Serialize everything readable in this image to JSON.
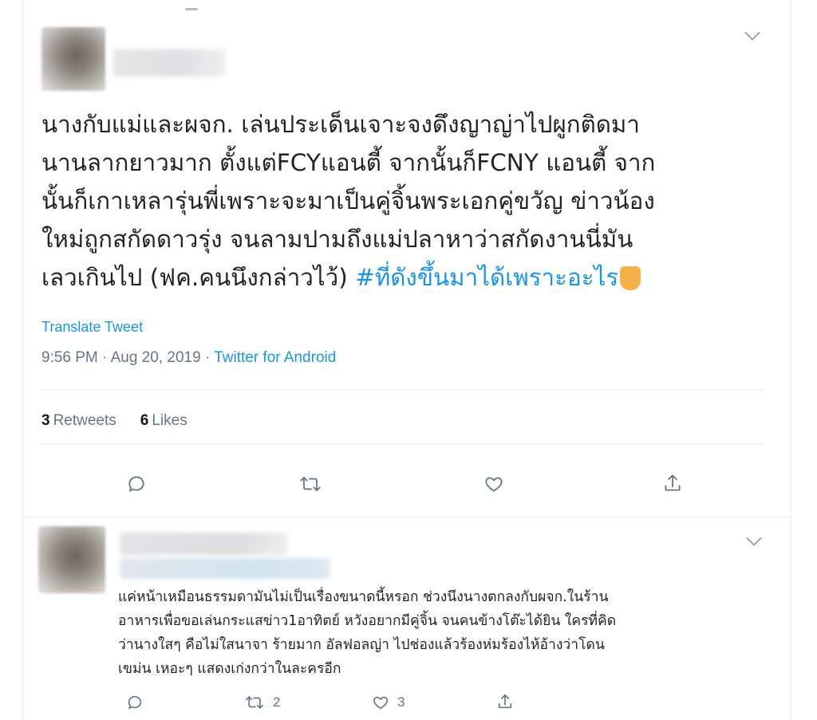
{
  "tweet": {
    "text_lines": [
      "นางกับแม่และผจก. เล่นประเด็นเจาะจงดึงญาญ่าไปผูกติดมา",
      "นานลากยาวมาก ตั้งแต่FCYแอนตี้ จากนั้นก็FCNY แอนตี้ จาก",
      "นั้นก็เกาเหลารุ่นพี่เพราะจะมาเป็นคู่จิ้นพระเอกคู่ขวัญ ข่าวน้อง",
      "ใหม่ถูกสกัดดาวรุ่ง  จนลามปามถึงแม่ปลาหาว่าสกัดงานนี่มัน",
      "เลวเกินไป (ฟค.คนนึงกล่าวไว้) "
    ],
    "hashtag": "#ที่ดังขึ้นมาได้เพราะอะไร",
    "translate_label": "Translate Tweet",
    "timestamp": "9:56 PM · Aug 20, 2019 · ",
    "source": "Twitter for Android",
    "retweets_count": "3",
    "retweets_label": "Retweets",
    "likes_count": "6",
    "likes_label": "Likes"
  },
  "reply": {
    "text_lines": [
      "แค่หน้าเหมือนธรรมดามันไม่เป็นเรื่องขนาดนี้หรอก ช่วงนึงนางตกลงกับผจก.ในร้าน",
      "อาหารเพื่อขอเล่นกระแสข่าว1อาทิตย์ หวังอยากมีคู่จิ้น จนคนข้างโต๊ะได้ยิน ใครที่คิด",
      "ว่านางใสๆ คือไม่ใสนาจา ร้ายมาก อัลฟอลญ่า ไปช่องแล้วร้องห่มร้องไห้อ้างว่าโดน",
      "เขม่น เหอะๆ แสดงเก่งกว่าในละครอีก"
    ],
    "retweet_count": "2",
    "like_count": "3"
  },
  "colors": {
    "link": "#1b95e0",
    "muted": "#657786",
    "text": "#14171a",
    "divider": "#e6ecf0"
  },
  "icons": [
    "chevron-down-icon",
    "reply-icon",
    "retweet-icon",
    "like-icon",
    "share-icon",
    "thumbs-down-emoji"
  ]
}
